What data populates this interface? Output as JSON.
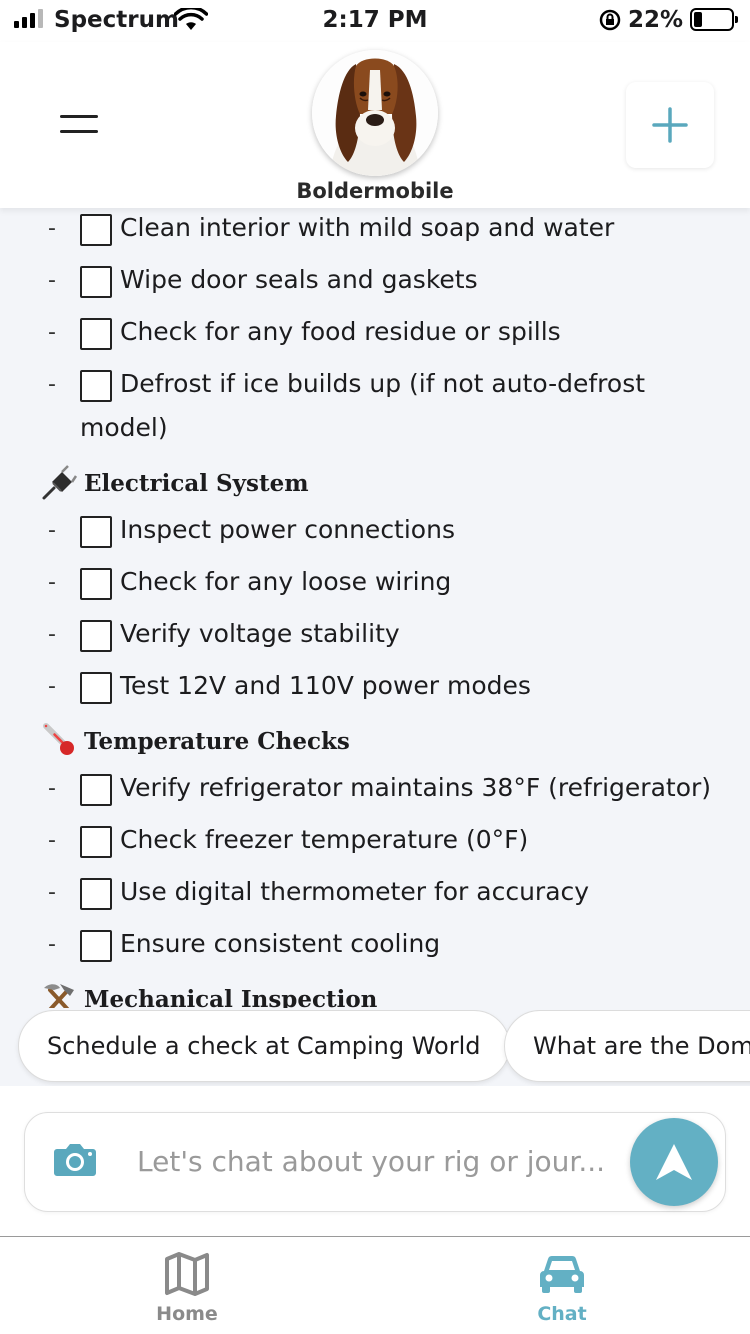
{
  "status_bar": {
    "carrier": "Spectrum",
    "time": "2:17 PM",
    "battery": "22%"
  },
  "header": {
    "app_name": "Boldermobile",
    "menu_icon": "hamburger-menu-icon",
    "add_icon": "plus-icon"
  },
  "checklist": {
    "top_items": [
      "Clean interior with mild soap and water",
      "Wipe door seals and gaskets",
      "Check for any food residue or spills"
    ],
    "wrap_item": {
      "line1": "Defrost if ice builds up (if not auto-defrost",
      "line2": "model)"
    },
    "sections": [
      {
        "icon": "🔌",
        "title": "Electrical System",
        "items": [
          "Inspect power connections",
          "Check for any loose wiring",
          "Verify voltage stability",
          "Test 12V and 110V power modes"
        ]
      },
      {
        "icon": "🌡️",
        "title": "Temperature Checks",
        "items": [
          "Verify refrigerator maintains 38°F (refrigerator)",
          "Check freezer temperature (0°F)",
          "Use digital thermometer for accuracy",
          "Ensure consistent cooling"
        ]
      },
      {
        "icon": "⚒️",
        "title": "Mechanical Inspection",
        "items": []
      }
    ]
  },
  "suggestions": [
    "Schedule a check at Camping World",
    "What are the Dome"
  ],
  "composer": {
    "placeholder": "Let's chat about your rig or jour..."
  },
  "tabs": [
    {
      "label": "Home",
      "icon": "map-icon",
      "active": false
    },
    {
      "label": "Chat",
      "icon": "car-icon",
      "active": true
    }
  ],
  "colors": {
    "accent": "#63b0c4",
    "inactive": "#8a8a8a",
    "background": "#f3f5f9"
  }
}
